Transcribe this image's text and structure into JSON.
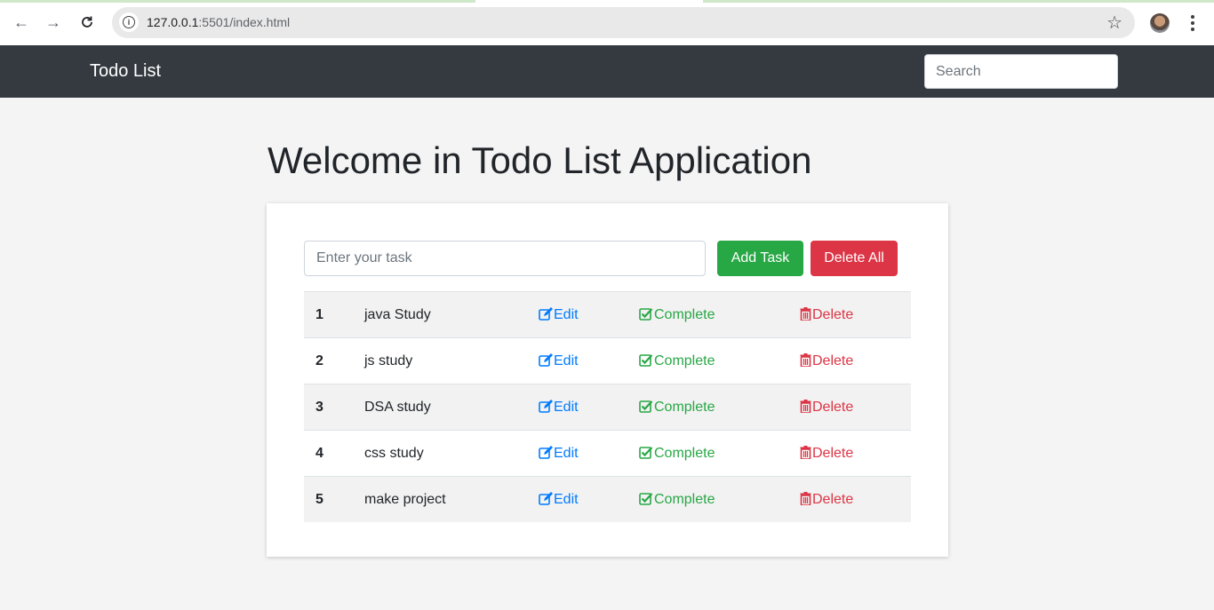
{
  "browser": {
    "url_host": "127.0.0.1",
    "url_rest": ":5501/index.html"
  },
  "navbar": {
    "brand": "Todo List",
    "search_placeholder": "Search"
  },
  "main": {
    "heading": "Welcome in Todo List Application",
    "task_input_placeholder": "Enter your task",
    "add_button": "Add Task",
    "delete_all_button": "Delete All"
  },
  "tasks": [
    {
      "num": "1",
      "text": "java Study",
      "edit": "Edit",
      "complete": "Complete",
      "delete": "Delete"
    },
    {
      "num": "2",
      "text": "js study",
      "edit": "Edit",
      "complete": "Complete",
      "delete": "Delete"
    },
    {
      "num": "3",
      "text": "DSA study",
      "edit": "Edit",
      "complete": "Complete",
      "delete": "Delete"
    },
    {
      "num": "4",
      "text": "css study",
      "edit": "Edit",
      "complete": "Complete",
      "delete": "Delete"
    },
    {
      "num": "5",
      "text": "make project",
      "edit": "Edit",
      "complete": "Complete",
      "delete": "Delete"
    }
  ],
  "colors": {
    "navbar": "#343a40",
    "success": "#28a745",
    "danger": "#dc3545",
    "primary": "#007bff"
  }
}
